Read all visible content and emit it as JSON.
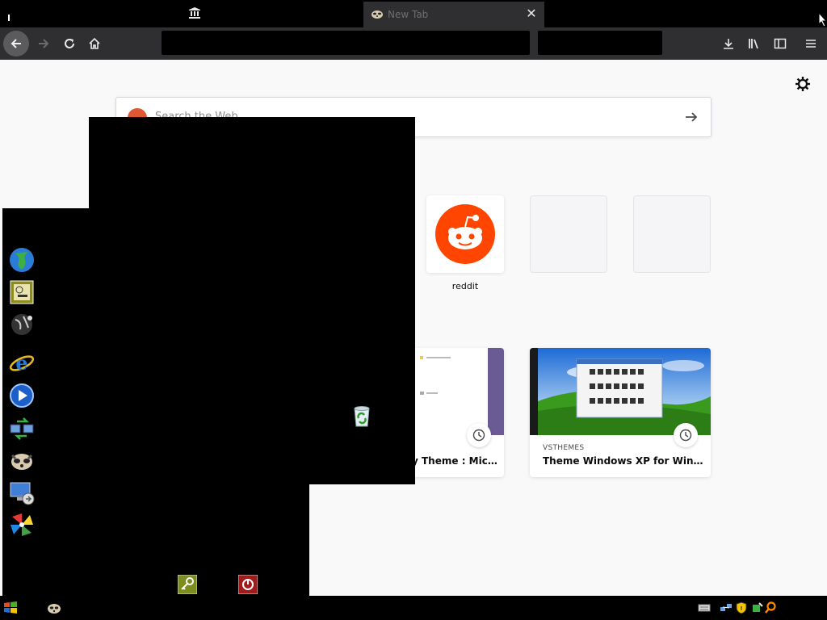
{
  "browser": {
    "tabs": [
      {
        "label": "",
        "kind": "pinned",
        "icon": "museum-icon"
      },
      {
        "label": "New Tab",
        "kind": "active",
        "icon": "raccoon-icon"
      }
    ],
    "search_placeholder": "Search the Web",
    "accent": "#ff4500"
  },
  "top_sites": [
    {
      "label": "reddit",
      "icon": "reddit-icon"
    },
    {
      "label": "",
      "icon": ""
    },
    {
      "label": "",
      "icon": ""
    }
  ],
  "highlights": [
    {
      "source": "",
      "title": "y Theme : Micr...",
      "thumbnail": "explorer-window-thumbnail"
    },
    {
      "source": "VSTHEMES",
      "title": "Theme Windows XP for Window...",
      "thumbnail": "windows-xp-bliss-thumbnail"
    }
  ],
  "start_menu": {
    "left_icons": [
      "globe-icon",
      "clock-tile-icon",
      "earth-night-icon",
      "internet-explorer-icon",
      "media-player-icon",
      "network-transfer-icon",
      "raccoon-icon",
      "remote-desktop-icon",
      "pinwheel-icon"
    ],
    "right_icons": [
      "documents-folder-icon",
      "recent-items-icon",
      "pictures-folder-icon",
      "music-folder-icon",
      "computer-icon",
      "control-panel-icon",
      "default-programs-icon",
      "printers-icon",
      "help-icon",
      "search-icon",
      "run-icon"
    ],
    "power_icons": [
      "log-off-key-icon",
      "shutdown-icon"
    ],
    "recycle_bin": "recycle-bin-icon"
  },
  "taskbar": {
    "tray_icons": [
      "keyboard-icon",
      "network-icon",
      "security-shield-icon",
      "safely-remove-icon",
      "search-tray-icon"
    ]
  }
}
